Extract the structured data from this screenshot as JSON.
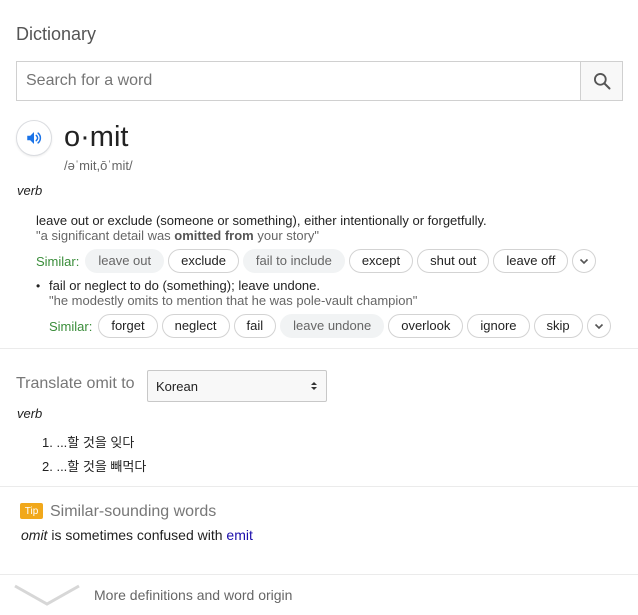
{
  "header": {
    "title": "Dictionary"
  },
  "search": {
    "placeholder": "Search for a word",
    "value": ""
  },
  "entry": {
    "headword": "o·mit",
    "phonetic": "/əˈmit,ōˈmit/",
    "pos": "verb",
    "senses": [
      {
        "definition": "leave out or exclude (someone or something), either intentionally or forgetfully.",
        "example_pre": "\"a significant detail was ",
        "example_bold": "omitted from",
        "example_post": " your story\"",
        "similar_label": "Similar:",
        "similar": [
          {
            "word": "leave out",
            "style": "filled"
          },
          {
            "word": "exclude",
            "style": "outlined"
          },
          {
            "word": "fail to include",
            "style": "filled"
          },
          {
            "word": "except",
            "style": "outlined"
          },
          {
            "word": "shut out",
            "style": "outlined"
          },
          {
            "word": "leave off",
            "style": "outlined"
          }
        ]
      },
      {
        "definition": "fail or neglect to do (something); leave undone.",
        "example": "\"he modestly omits to mention that he was pole-vault champion\"",
        "similar_label": "Similar:",
        "similar": [
          {
            "word": "forget",
            "style": "outlined"
          },
          {
            "word": "neglect",
            "style": "outlined"
          },
          {
            "word": "fail",
            "style": "outlined"
          },
          {
            "word": "leave undone",
            "style": "filled"
          },
          {
            "word": "overlook",
            "style": "outlined"
          },
          {
            "word": "ignore",
            "style": "outlined"
          },
          {
            "word": "skip",
            "style": "outlined"
          }
        ]
      }
    ]
  },
  "translate": {
    "label": "Translate omit to",
    "language": "Korean",
    "pos": "verb",
    "items": [
      "1. ...할 것을 잊다",
      "2. ...할 것을 빼먹다"
    ]
  },
  "tip": {
    "badge": "Tip",
    "title": "Similar-sounding words",
    "word": "omit",
    "middle": " is sometimes confused with ",
    "link": "emit"
  },
  "footer": {
    "more": "More definitions and word origin"
  },
  "colors": {
    "similar_label": "#3a8d3a",
    "link": "#1a0dab",
    "tip_badge": "#f1a81b"
  }
}
